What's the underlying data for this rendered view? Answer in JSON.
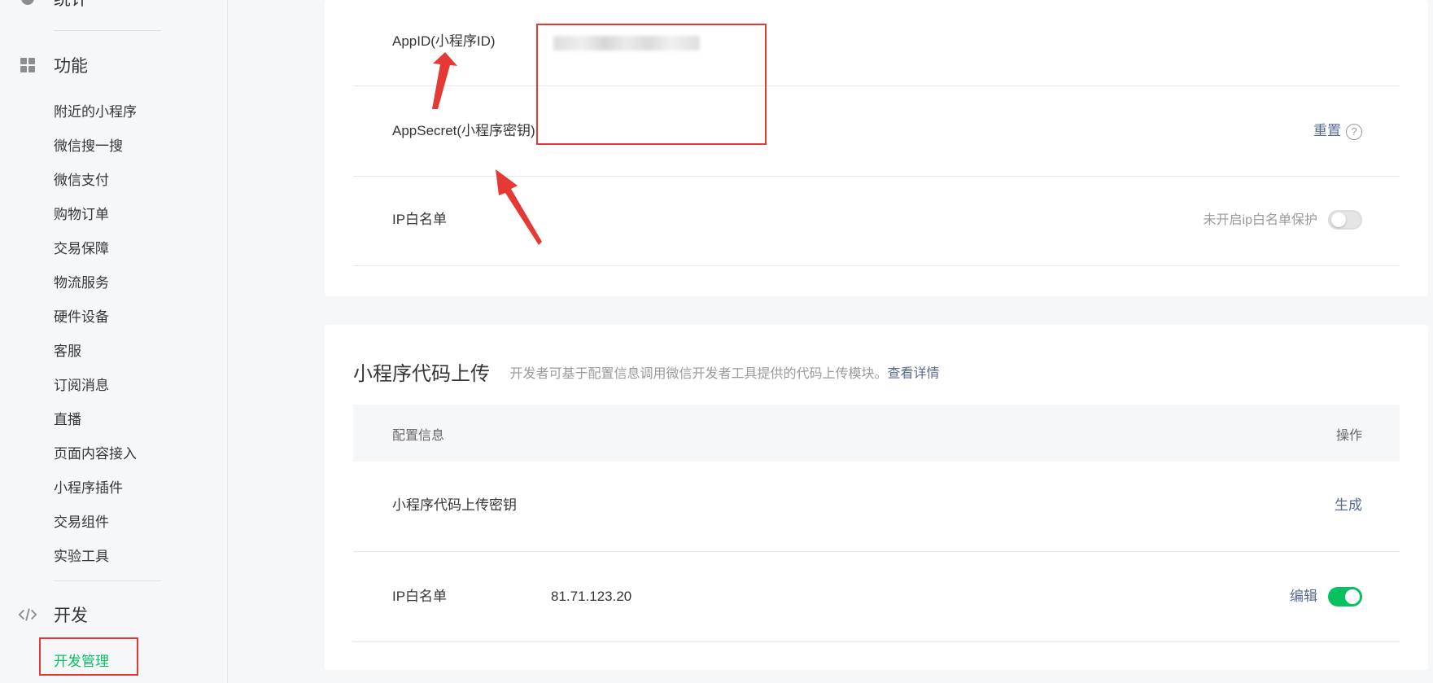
{
  "sidebar": {
    "top_item": "统计",
    "groups": [
      {
        "label": "功能",
        "icon": "grid-icon"
      },
      {
        "label": "开发",
        "icon": "code-icon"
      }
    ],
    "function_items": [
      "附近的小程序",
      "微信搜一搜",
      "微信支付",
      "购物订单",
      "交易保障",
      "物流服务",
      "硬件设备",
      "客服",
      "订阅消息",
      "直播",
      "页面内容接入",
      "小程序插件",
      "交易组件",
      "实验工具"
    ],
    "dev_items": [
      "开发管理"
    ],
    "active_item": "开发管理"
  },
  "dev_settings": {
    "appid_label": "AppID(小程序ID)",
    "appsecret_label": "AppSecret(小程序密钥)",
    "reset_link": "重置",
    "help_icon": "question-circle-icon",
    "ip_whitelist_label": "IP白名单",
    "ip_whitelist_status": "未开启ip白名单保护",
    "ip_whitelist_enabled": false
  },
  "code_upload": {
    "title": "小程序代码上传",
    "description": "开发者可基于配置信息调用微信开发者工具提供的代码上传模块。",
    "details_link": "查看详情",
    "table_header": {
      "config": "配置信息",
      "action": "操作"
    },
    "rows": [
      {
        "label": "小程序代码上传密钥",
        "value": "",
        "action": "生成"
      },
      {
        "label": "IP白名单",
        "value": "81.71.123.20",
        "action": "编辑",
        "toggle_on": true
      }
    ]
  },
  "colors": {
    "accent_green": "#07c160",
    "link_blue": "#576b95",
    "annotation_red": "#e53935"
  }
}
